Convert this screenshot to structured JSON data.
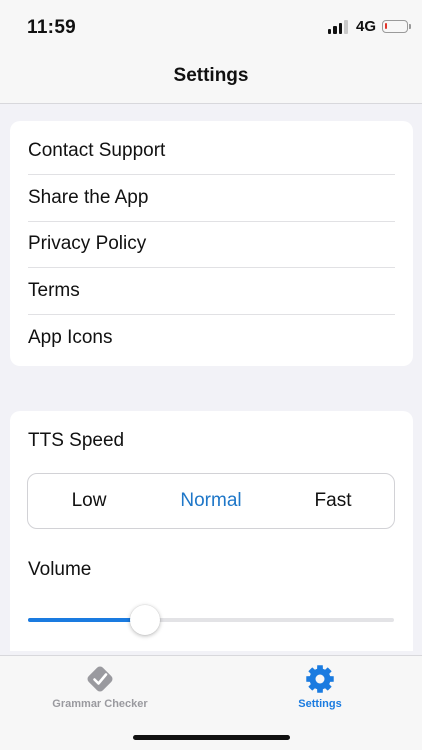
{
  "status_bar": {
    "time": "11:59",
    "network": "4G",
    "battery_level": 0.1,
    "battery_color": "#e2352b"
  },
  "nav": {
    "title": "Settings"
  },
  "links": [
    {
      "label": "Contact Support"
    },
    {
      "label": "Share the App"
    },
    {
      "label": "Privacy Policy"
    },
    {
      "label": "Terms"
    },
    {
      "label": "App Icons"
    }
  ],
  "tts": {
    "label": "TTS Speed",
    "options": [
      "Low",
      "Normal",
      "Fast"
    ],
    "selected": "Normal"
  },
  "volume": {
    "label": "Volume",
    "value": 0.32
  },
  "tab_bar": {
    "tabs": [
      {
        "label": "Grammar Checker",
        "icon": "checkmark-diamond-icon",
        "active": false
      },
      {
        "label": "Settings",
        "icon": "gear-icon",
        "active": true
      }
    ]
  },
  "colors": {
    "accent": "#1a7be0",
    "segment_active": "#1f77c8",
    "inactive_tab": "#9a9a9f",
    "background": "#f2f2f7"
  }
}
